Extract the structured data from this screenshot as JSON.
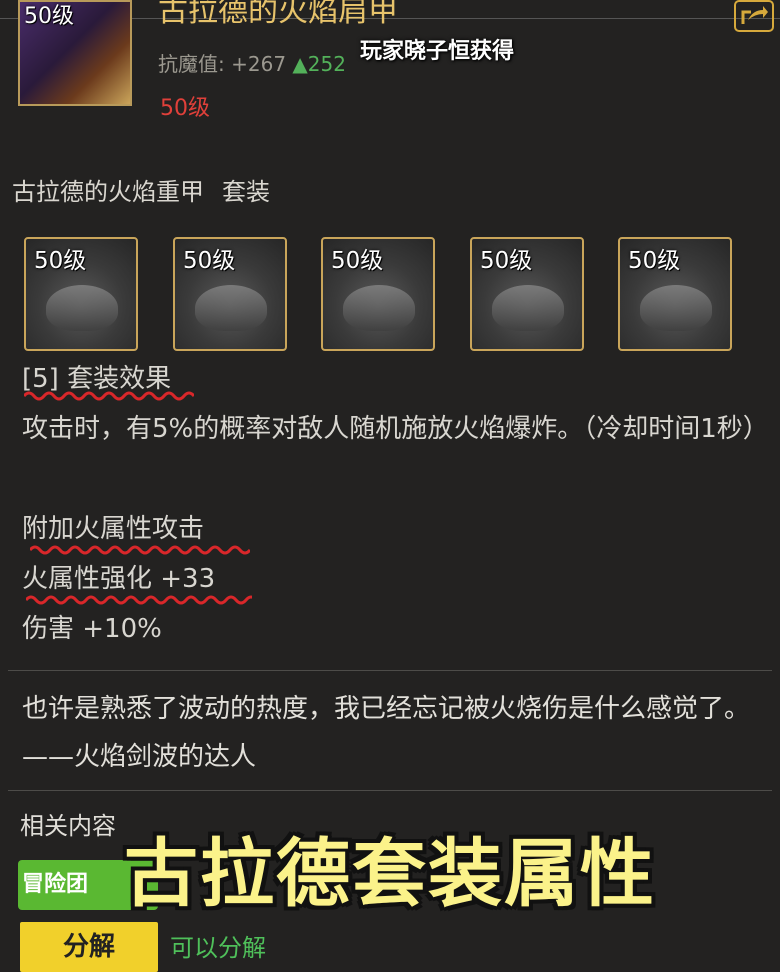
{
  "item": {
    "level_badge": "50级",
    "name": "古拉德的火焰肩甲",
    "stat_label": "抗魔值:",
    "stat_value": "+267",
    "stat_diff": "▲252",
    "required_level": "50级"
  },
  "watermark_top": "玩家晓子恒获得",
  "set": {
    "title": "古拉德的火焰重甲",
    "tag": "套装",
    "pieces": [
      {
        "level": "50级"
      },
      {
        "level": "50级"
      },
      {
        "level": "50级"
      },
      {
        "level": "50级"
      },
      {
        "level": "50级"
      }
    ],
    "count_label": "[5] 套装效果",
    "effect_desc": "攻击时，有5%的概率对敌人随机施放火焰爆炸。（冷却时间1秒）",
    "bonus_title": "附加火属性攻击",
    "bonus_stat": "火属性强化 +33",
    "bonus_dmg": "伤害 +10%"
  },
  "flavor_text": "也许是熟悉了波动的热度，我已经忘记被火烧伤是什么感觉了。 ——火焰剑波的达人",
  "related": {
    "label": "相关内容",
    "adventure_button": "冒险团"
  },
  "actions": {
    "decompose_button": "分解",
    "decompose_note": "可以分解"
  },
  "caption": "古拉德套装属性",
  "colors": {
    "background": "#232221",
    "item_name": "#e7c36b",
    "required_level": "#e0403a",
    "green_text": "#4fc05a",
    "caption": "#fbf28a",
    "underline": "#d9272a"
  },
  "icons": {
    "share": "share-icon",
    "item": "shoulder-armor-icon"
  }
}
